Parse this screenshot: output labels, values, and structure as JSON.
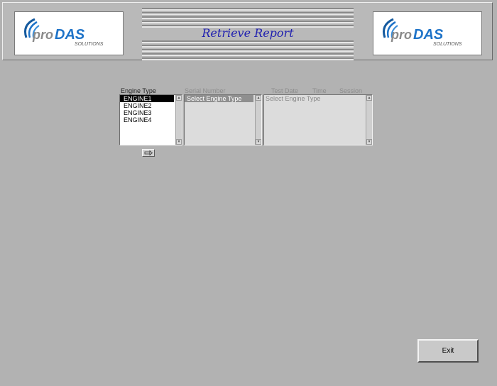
{
  "header": {
    "title": "Retrieve Report",
    "logo_left": {
      "brand_prefix": "pro",
      "brand_main": "DAS",
      "tagline": "SOLUTIONS"
    },
    "logo_right": {
      "brand_prefix": "pro",
      "brand_main": "DAS",
      "tagline": "SOLUTIONS"
    }
  },
  "columns": {
    "engine_type": "Engine Type",
    "serial_number": "Serial Number",
    "test_date": "Test Date",
    "time": "Time",
    "session": "Session"
  },
  "engine_list": [
    "ENGINE1",
    "ENGINE2",
    "ENGINE3",
    "ENGINE4"
  ],
  "serial_list": [
    "Select Engine Type"
  ],
  "detail_list": [
    "Select Engine Type"
  ],
  "exit_label": "Exit",
  "colors": {
    "title": "#1f1fb0",
    "logo_blue": "#1e73c8",
    "logo_swirl": "#155a9e",
    "background": "#b2b2b2"
  },
  "icons": {
    "go_button": "arrow-right-icon"
  }
}
